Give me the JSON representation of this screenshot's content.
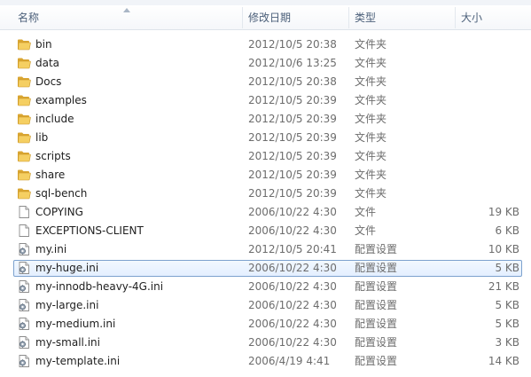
{
  "columns": {
    "name": "名称",
    "date": "修改日期",
    "type": "类型",
    "size": "大小"
  },
  "files": [
    {
      "name": "bin",
      "date": "2012/10/5 20:38",
      "type": "文件夹",
      "size": "",
      "icon": "folder-icon"
    },
    {
      "name": "data",
      "date": "2012/10/6 13:25",
      "type": "文件夹",
      "size": "",
      "icon": "folder-icon"
    },
    {
      "name": "Docs",
      "date": "2012/10/5 20:38",
      "type": "文件夹",
      "size": "",
      "icon": "folder-icon"
    },
    {
      "name": "examples",
      "date": "2012/10/5 20:39",
      "type": "文件夹",
      "size": "",
      "icon": "folder-icon"
    },
    {
      "name": "include",
      "date": "2012/10/5 20:39",
      "type": "文件夹",
      "size": "",
      "icon": "folder-icon"
    },
    {
      "name": "lib",
      "date": "2012/10/5 20:39",
      "type": "文件夹",
      "size": "",
      "icon": "folder-icon"
    },
    {
      "name": "scripts",
      "date": "2012/10/5 20:39",
      "type": "文件夹",
      "size": "",
      "icon": "folder-icon"
    },
    {
      "name": "share",
      "date": "2012/10/5 20:39",
      "type": "文件夹",
      "size": "",
      "icon": "folder-icon"
    },
    {
      "name": "sql-bench",
      "date": "2012/10/5 20:39",
      "type": "文件夹",
      "size": "",
      "icon": "folder-icon"
    },
    {
      "name": "COPYING",
      "date": "2006/10/22 4:30",
      "type": "文件",
      "size": "19 KB",
      "icon": "file-icon"
    },
    {
      "name": "EXCEPTIONS-CLIENT",
      "date": "2006/10/22 4:30",
      "type": "文件",
      "size": "6 KB",
      "icon": "file-icon"
    },
    {
      "name": "my.ini",
      "date": "2012/10/5 20:41",
      "type": "配置设置",
      "size": "10 KB",
      "icon": "settings-file-icon"
    },
    {
      "name": "my-huge.ini",
      "date": "2006/10/22 4:30",
      "type": "配置设置",
      "size": "5 KB",
      "icon": "settings-file-icon",
      "selected": true
    },
    {
      "name": "my-innodb-heavy-4G.ini",
      "date": "2006/10/22 4:30",
      "type": "配置设置",
      "size": "21 KB",
      "icon": "settings-file-icon"
    },
    {
      "name": "my-large.ini",
      "date": "2006/10/22 4:30",
      "type": "配置设置",
      "size": "5 KB",
      "icon": "settings-file-icon"
    },
    {
      "name": "my-medium.ini",
      "date": "2006/10/22 4:30",
      "type": "配置设置",
      "size": "5 KB",
      "icon": "settings-file-icon"
    },
    {
      "name": "my-small.ini",
      "date": "2006/10/22 4:30",
      "type": "配置设置",
      "size": "3 KB",
      "icon": "settings-file-icon"
    },
    {
      "name": "my-template.ini",
      "date": "2006/4/19 4:41",
      "type": "配置设置",
      "size": "14 KB",
      "icon": "settings-file-icon"
    }
  ],
  "colors": {
    "folder": "#e8b84a",
    "selection_border": "#7da2ce",
    "header_text": "#4c607a"
  }
}
